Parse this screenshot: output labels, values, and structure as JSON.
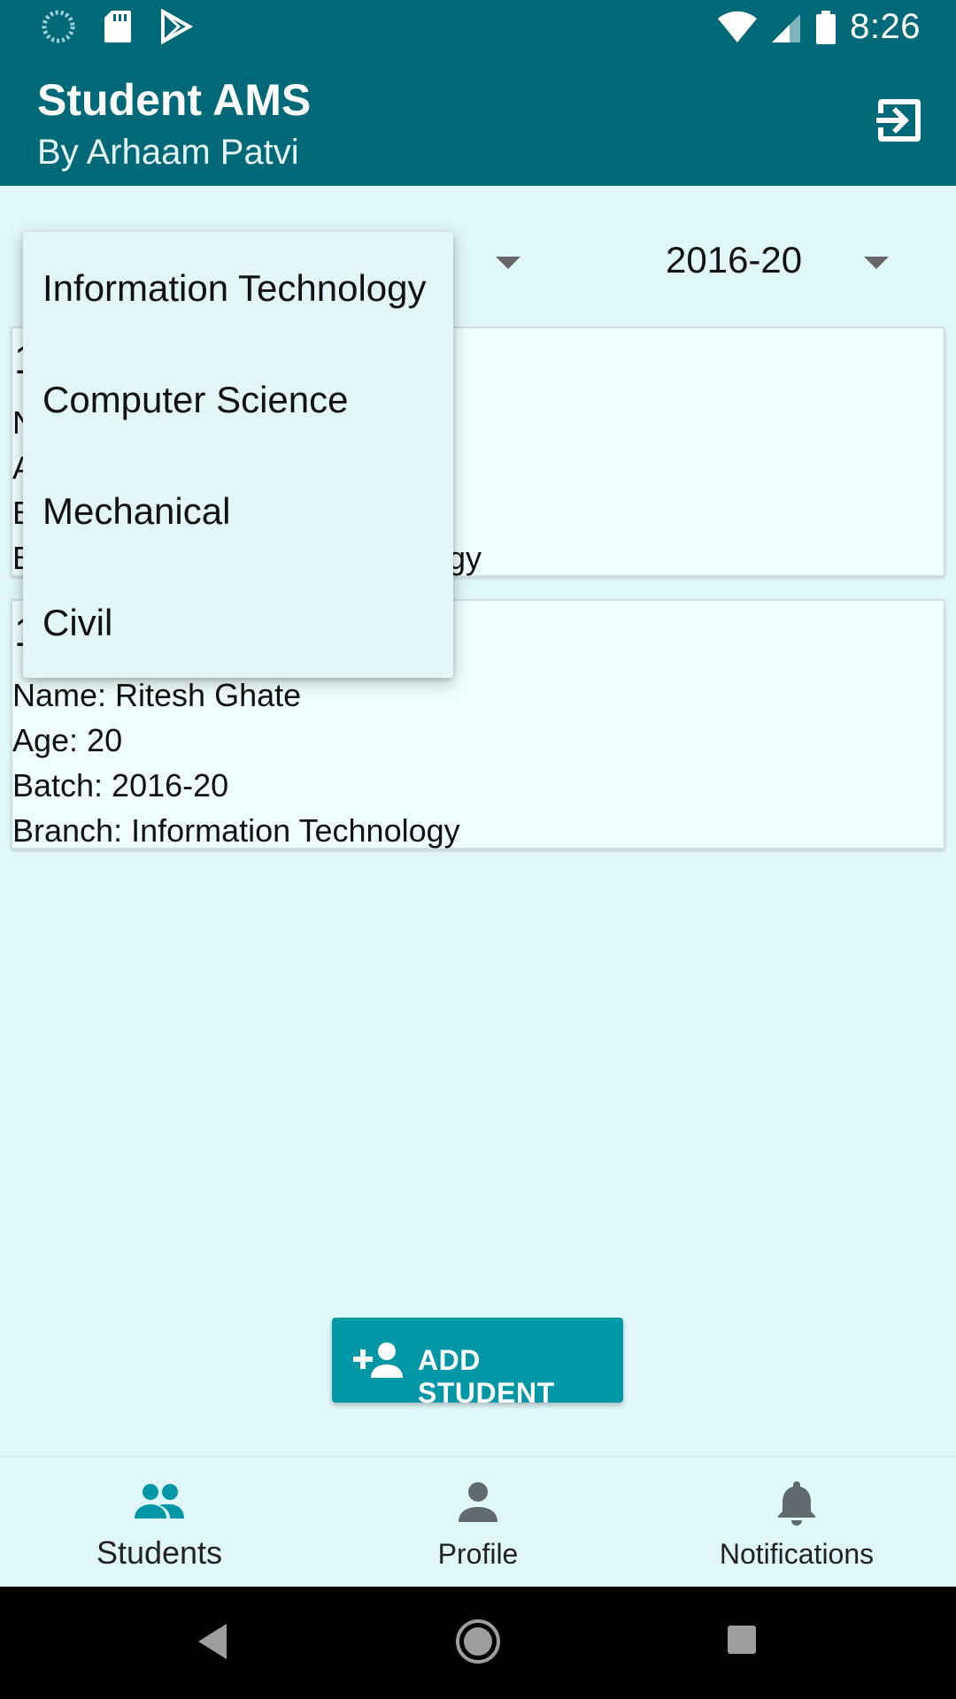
{
  "status_bar": {
    "time": "8:26",
    "icons": [
      "loading-icon",
      "sd-card-icon",
      "play-store-icon",
      "wifi-icon",
      "signal-icon",
      "battery-icon"
    ]
  },
  "app_bar": {
    "title": "Student AMS",
    "subtitle": "By Arhaam Patvi",
    "logout_icon": "logout-icon"
  },
  "filters": {
    "batch_value": "2016-20"
  },
  "branch_dropdown": {
    "options": [
      "Information Technology",
      "Computer Science",
      "Mechanical",
      "Civil"
    ]
  },
  "students": [
    {
      "num": "1",
      "lines": [
        "N",
        "A",
        "B",
        "B"
      ],
      "partial_right": "gy"
    },
    {
      "num": "1",
      "lines": [
        "Name: Ritesh Ghate",
        "Age: 20",
        "Batch: 2016-20",
        "Branch: Information Technology"
      ]
    }
  ],
  "add_button": {
    "label": "ADD STUDENT",
    "icon": "add-person-icon"
  },
  "bottom_nav": [
    {
      "label": "Students",
      "icon": "people-icon",
      "active": true
    },
    {
      "label": "Profile",
      "icon": "person-icon",
      "active": false
    },
    {
      "label": "Notifications",
      "icon": "bell-icon",
      "active": false
    }
  ],
  "colors": {
    "primary": "#006978",
    "accent": "#0097a7",
    "background": "#e0f7fa",
    "card": "#effefe"
  }
}
